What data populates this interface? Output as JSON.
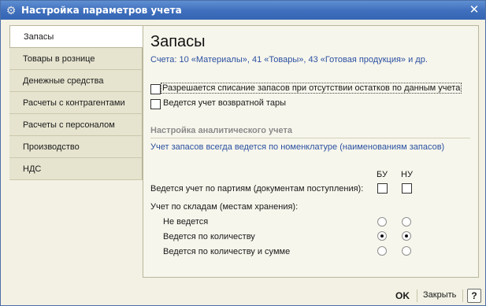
{
  "window": {
    "title": "Настройка параметров учета",
    "close_glyph": "✕"
  },
  "sidebar": {
    "items": [
      {
        "label": "Запасы",
        "active": true
      },
      {
        "label": "Товары в рознице",
        "active": false
      },
      {
        "label": "Денежные средства",
        "active": false
      },
      {
        "label": "Расчеты с контрагентами",
        "active": false
      },
      {
        "label": "Расчеты с персоналом",
        "active": false
      },
      {
        "label": "Производство",
        "active": false
      },
      {
        "label": "НДС",
        "active": false
      }
    ]
  },
  "main": {
    "title": "Запасы",
    "accounts_link": "Счета: 10 «Материалы», 41 «Товары», 43 «Готовая продукция» и др.",
    "options": [
      {
        "label": "Разрешается списание запасов при отсутствии остатков по данным учета",
        "checked": false
      },
      {
        "label": "Ведется учет возвратной тары",
        "checked": false
      }
    ],
    "analytics": {
      "header": "Настройка аналитического учета",
      "info": "Учет запасов всегда ведется по номенклатуре (наименованиям запасов)",
      "col_bu": "БУ",
      "col_nu": "НУ",
      "batches_label": "Ведется учет по партиям (документам поступления):",
      "batches": {
        "bu": false,
        "nu": false
      },
      "warehouses_label": "Учет по складам (местам хранения):",
      "warehouse_options": [
        {
          "label": "Не ведется",
          "bu": false,
          "nu": false
        },
        {
          "label": "Ведется по количеству",
          "bu": true,
          "nu": true
        },
        {
          "label": "Ведется по количеству и сумме",
          "bu": false,
          "nu": false
        }
      ]
    }
  },
  "footer": {
    "ok_label": "OK",
    "close_label": "Закрыть",
    "help_label": "?"
  },
  "colors": {
    "title_bar": "#3e6ebc",
    "link_blue": "#2b50a1",
    "panel_bg": "#f2f1e4"
  }
}
